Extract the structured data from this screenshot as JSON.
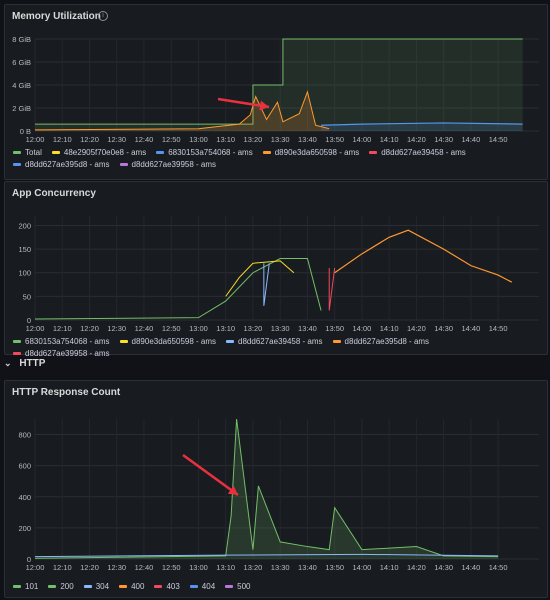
{
  "panels": {
    "memory": {
      "title": "Memory Utilization",
      "info_icon": "info-icon",
      "y_ticks": [
        "0 B",
        "2 GiB",
        "4 GiB",
        "6 GiB",
        "8 GiB"
      ],
      "x_ticks": [
        "12:00",
        "12:10",
        "12:20",
        "12:30",
        "12:40",
        "12:50",
        "13:00",
        "13:10",
        "13:20",
        "13:30",
        "13:40",
        "13:50",
        "14:00",
        "14:10",
        "14:20",
        "14:30",
        "14:40",
        "14:50"
      ],
      "legend": [
        {
          "label": "Total",
          "color": "#73bf69"
        },
        {
          "label": "48e2905f70e0e8 - ams",
          "color": "#fade2a"
        },
        {
          "label": "6830153a754068 - ams",
          "color": "#5794f2"
        },
        {
          "label": "d890e3da650598 - ams",
          "color": "#ff9830"
        },
        {
          "label": "d8dd627ae39458 - ams",
          "color": "#f2495c"
        },
        {
          "label": "d8dd627ae395d8 - ams",
          "color": "#5794f2"
        },
        {
          "label": "d8dd627ae39958 - ams",
          "color": "#b877d9"
        }
      ]
    },
    "concurrency": {
      "title": "App Concurrency",
      "y_ticks": [
        "0",
        "50",
        "100",
        "150",
        "200"
      ],
      "x_ticks": [
        "12:00",
        "12:10",
        "12:20",
        "12:30",
        "12:40",
        "12:50",
        "13:00",
        "13:10",
        "13:20",
        "13:30",
        "13:40",
        "13:50",
        "14:00",
        "14:10",
        "14:20",
        "14:30",
        "14:40",
        "14:50"
      ],
      "legend": [
        {
          "label": "6830153a754068 - ams",
          "color": "#73bf69"
        },
        {
          "label": "d890e3da650598 - ams",
          "color": "#fade2a"
        },
        {
          "label": "d8dd627ae39458 - ams",
          "color": "#8ab8ff"
        },
        {
          "label": "d8dd627ae395d8 - ams",
          "color": "#ff9830"
        },
        {
          "label": "d8dd627ae39958 - ams",
          "color": "#f2495c"
        }
      ]
    },
    "http": {
      "title": "HTTP Response Count",
      "y_ticks": [
        "0",
        "200",
        "400",
        "600",
        "800"
      ],
      "x_ticks": [
        "12:00",
        "12:10",
        "12:20",
        "12:30",
        "12:40",
        "12:50",
        "13:00",
        "13:10",
        "13:20",
        "13:30",
        "13:40",
        "13:50",
        "14:00",
        "14:10",
        "14:20",
        "14:30",
        "14:40",
        "14:50"
      ],
      "legend": [
        {
          "label": "101",
          "color": "#73bf69"
        },
        {
          "label": "200",
          "color": "#73bf69"
        },
        {
          "label": "304",
          "color": "#8ab8ff"
        },
        {
          "label": "400",
          "color": "#ff9830"
        },
        {
          "label": "403",
          "color": "#f2495c"
        },
        {
          "label": "404",
          "color": "#5794f2"
        },
        {
          "label": "500",
          "color": "#b877d9"
        }
      ]
    }
  },
  "section": {
    "title": "HTTP",
    "icon": "chevron-down-icon"
  },
  "chart_data": [
    {
      "type": "line",
      "title": "Memory Utilization",
      "ylim": [
        0,
        8
      ],
      "ylabel_unit": "GiB",
      "series": [
        {
          "name": "Total",
          "x": [
            "12:00",
            "13:20",
            "13:20",
            "13:31",
            "13:31",
            "13:41",
            "13:41",
            "14:59"
          ],
          "values": [
            0.6,
            0.6,
            4,
            4,
            8,
            8,
            8,
            8
          ]
        },
        {
          "name": "d890e3da650598 - ams",
          "x": [
            "12:00",
            "13:00",
            "13:15",
            "13:19",
            "13:21",
            "13:25",
            "13:29",
            "13:31",
            "13:37",
            "13:40",
            "13:43",
            "13:48"
          ],
          "values": [
            0.1,
            0.2,
            0.6,
            1.4,
            3,
            1,
            2.5,
            0.8,
            1.5,
            3.4,
            0.5,
            0.2
          ]
        },
        {
          "name": "d8dd627ae395d8 - ams",
          "x": [
            "13:45",
            "14:00",
            "14:30",
            "14:59"
          ],
          "values": [
            0.5,
            0.6,
            0.7,
            0.6
          ]
        }
      ]
    },
    {
      "type": "line",
      "title": "App Concurrency",
      "ylim": [
        0,
        220
      ],
      "series": [
        {
          "name": "6830153a754068 - ams",
          "x": [
            "12:00",
            "13:00",
            "13:10",
            "13:20",
            "13:30",
            "13:40",
            "13:45"
          ],
          "values": [
            2,
            5,
            40,
            100,
            130,
            130,
            20
          ]
        },
        {
          "name": "d890e3da650598 - ams",
          "x": [
            "13:10",
            "13:15",
            "13:20",
            "13:30",
            "13:35"
          ],
          "values": [
            50,
            90,
            120,
            125,
            100
          ]
        },
        {
          "name": "d8dd627ae395d8 - ams",
          "x": [
            "13:50",
            "14:00",
            "14:10",
            "14:17",
            "14:30",
            "14:40",
            "14:50",
            "14:55"
          ],
          "values": [
            100,
            140,
            175,
            190,
            150,
            115,
            95,
            80
          ]
        }
      ]
    },
    {
      "type": "line",
      "title": "HTTP Response Count",
      "ylim": [
        0,
        900
      ],
      "series": [
        {
          "name": "200",
          "x": [
            "12:00",
            "13:10",
            "13:12",
            "13:14",
            "13:20",
            "13:22",
            "13:30",
            "13:40",
            "13:48",
            "13:50",
            "14:00",
            "14:20",
            "14:30",
            "14:50"
          ],
          "values": [
            5,
            20,
            280,
            900,
            60,
            470,
            110,
            80,
            60,
            330,
            60,
            80,
            20,
            15
          ]
        },
        {
          "name": "304",
          "x": [
            "12:00",
            "13:10",
            "14:00",
            "14:50"
          ],
          "values": [
            15,
            25,
            30,
            20
          ]
        }
      ]
    }
  ]
}
